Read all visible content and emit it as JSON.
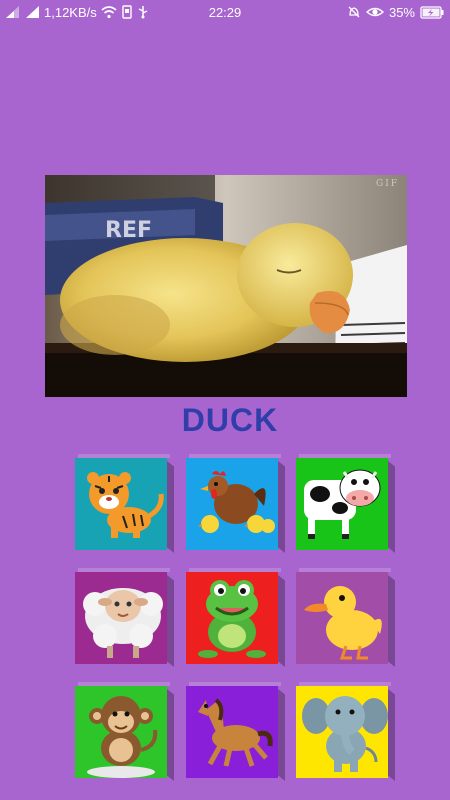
{
  "status_bar": {
    "network_speed": "1,12KB/s",
    "time": "22:29",
    "battery": "35%"
  },
  "player": {
    "badge": "GIF",
    "caption": "DUCK"
  },
  "colors": {
    "background": "#a865cf",
    "caption": "#2f3ea8"
  },
  "tiles": [
    {
      "animal": "tiger",
      "color": "#17a3b4"
    },
    {
      "animal": "hen",
      "color": "#1aa3e8"
    },
    {
      "animal": "cow",
      "color": "#17c417"
    },
    {
      "animal": "sheep",
      "color": "#9b2a91"
    },
    {
      "animal": "frog",
      "color": "#ee1f1f"
    },
    {
      "animal": "duck",
      "color": "#a24ea9"
    },
    {
      "animal": "monkey",
      "color": "#2dc52a"
    },
    {
      "animal": "horse",
      "color": "#8a1fd9"
    },
    {
      "animal": "elephant",
      "color": "#ffe600"
    }
  ]
}
